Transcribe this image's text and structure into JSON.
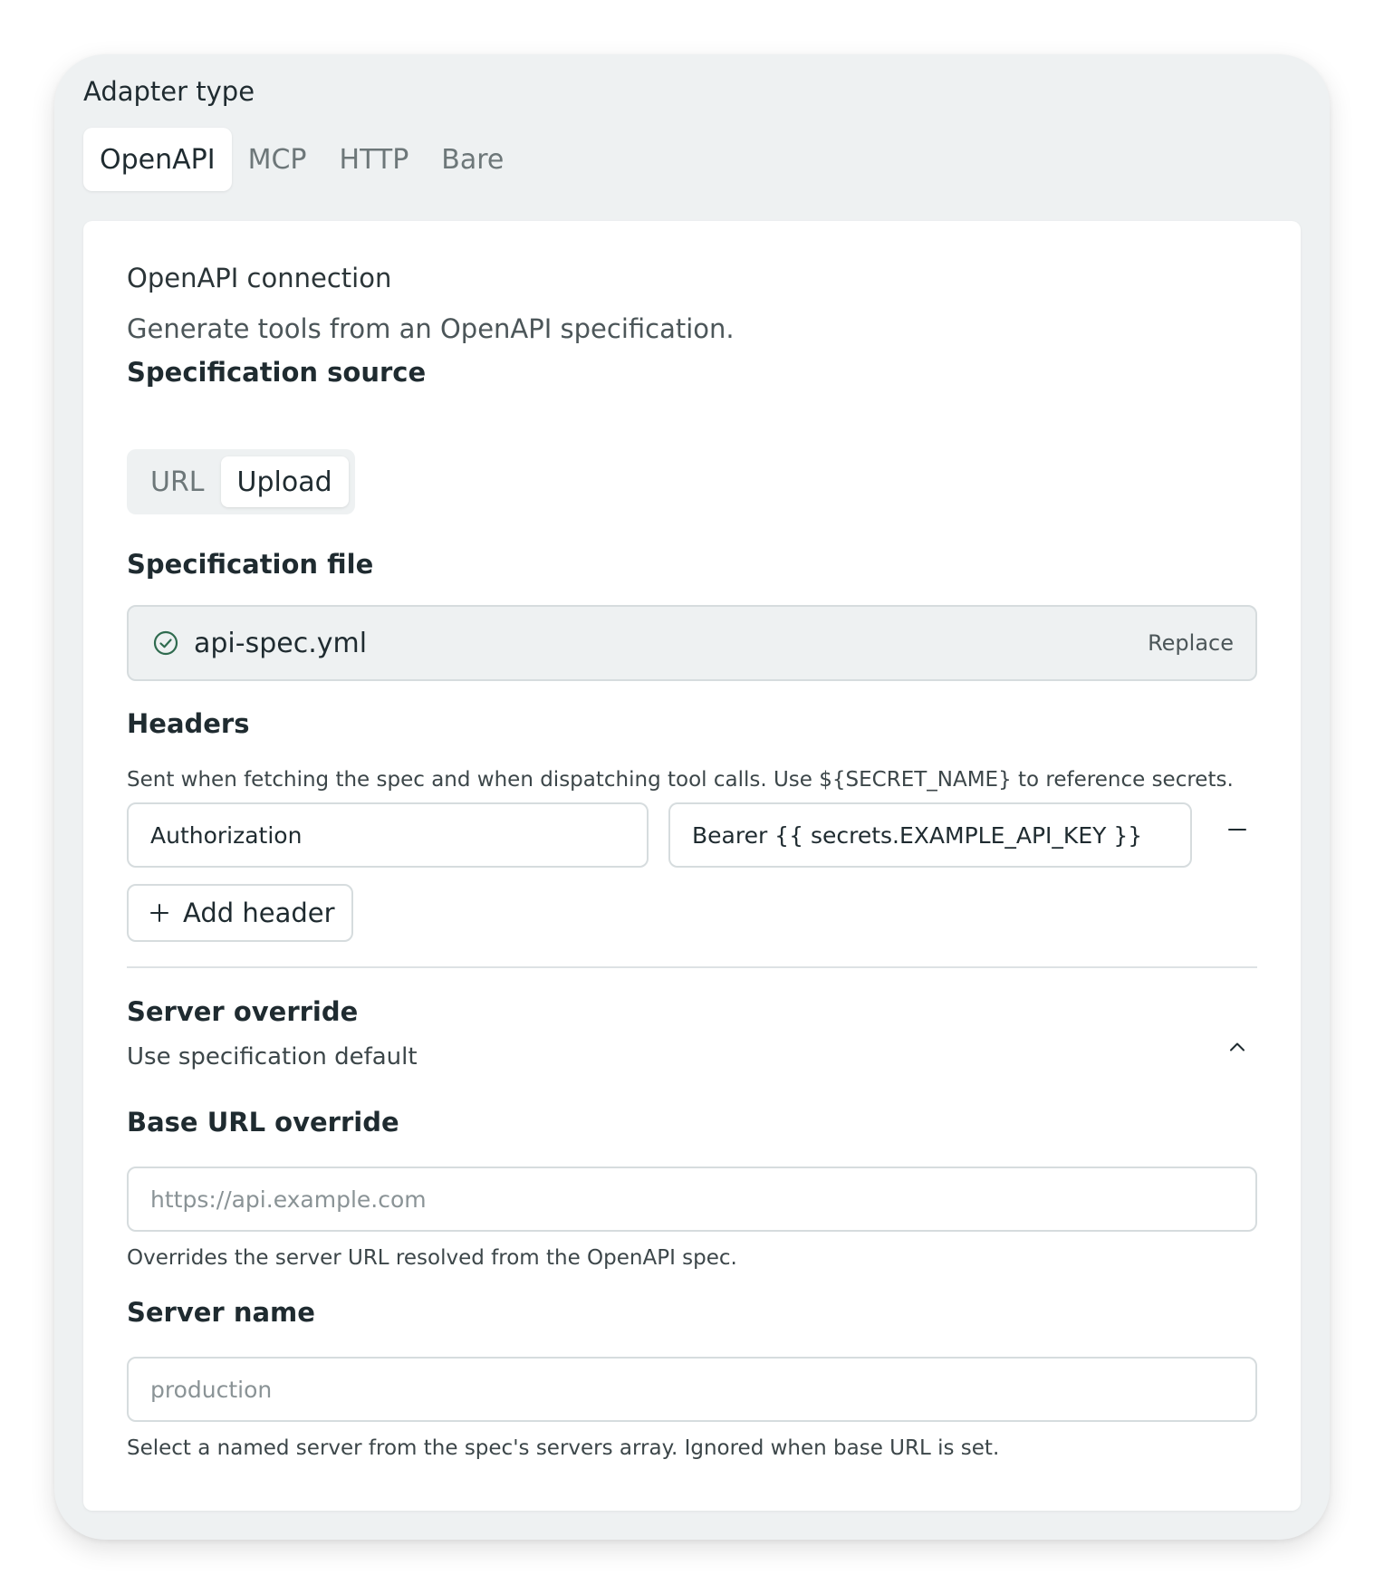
{
  "adapter": {
    "label": "Adapter type",
    "tabs": [
      {
        "label": "OpenAPI",
        "active": true
      },
      {
        "label": "MCP",
        "active": false
      },
      {
        "label": "HTTP",
        "active": false
      },
      {
        "label": "Bare",
        "active": false
      }
    ]
  },
  "connection": {
    "title": "OpenAPI connection",
    "description": "Generate tools from an OpenAPI specification."
  },
  "spec_source": {
    "label": "Specification source",
    "options": [
      {
        "label": "URL",
        "active": false
      },
      {
        "label": "Upload",
        "active": true
      }
    ]
  },
  "spec_file": {
    "label": "Specification file",
    "file_name": "api-spec.yml",
    "replace_label": "Replace",
    "status_icon": "check-circle-icon"
  },
  "headers": {
    "label": "Headers",
    "hint": "Sent when fetching the spec and when dispatching tool calls. Use ${SECRET_NAME} to reference secrets.",
    "rows": [
      {
        "name": "Authorization",
        "value": "Bearer {{ secrets.EXAMPLE_API_KEY }}"
      }
    ],
    "add_label": "Add header"
  },
  "server_override": {
    "label": "Server override",
    "summary": "Use specification default",
    "expanded": true,
    "base_url": {
      "label": "Base URL override",
      "placeholder": "https://api.example.com",
      "value": "",
      "hint": "Overrides the server URL resolved from the OpenAPI spec."
    },
    "server_name": {
      "label": "Server name",
      "placeholder": "production",
      "value": "",
      "hint": "Select a named server from the spec's servers array. Ignored when base URL is set."
    }
  },
  "colors": {
    "panel_bg": "#eef1f2",
    "card_bg": "#ffffff",
    "border": "#d6dcde",
    "text_primary": "#1f2b30",
    "text_muted": "#6d7779",
    "success_icon": "#2f6b4f"
  }
}
